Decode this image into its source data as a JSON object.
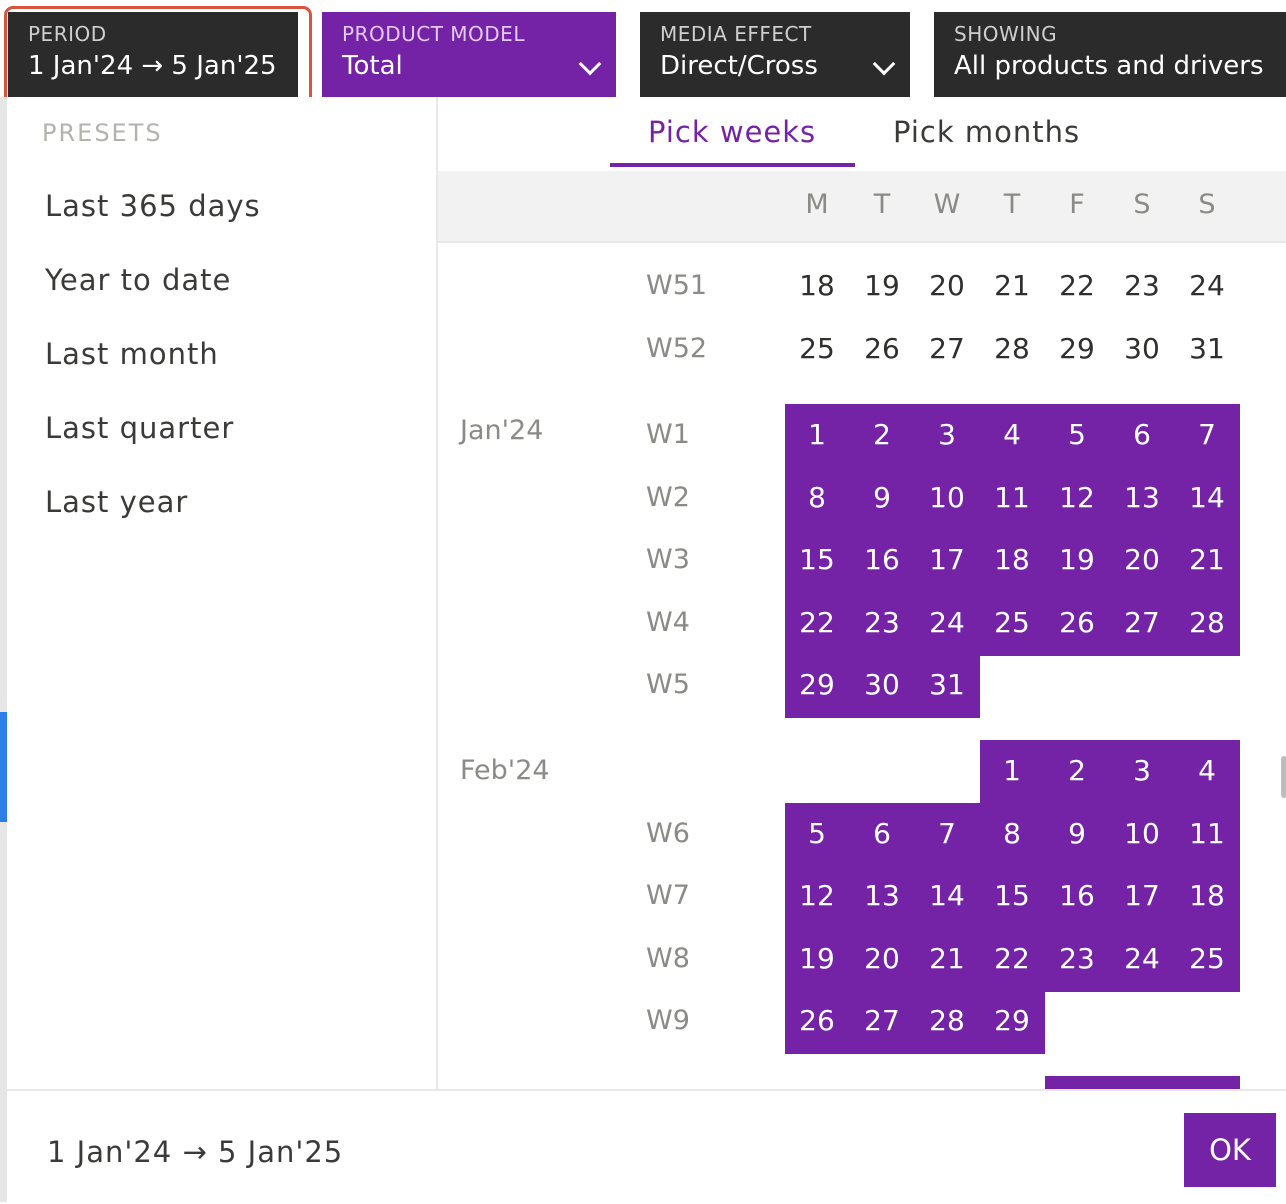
{
  "filters": {
    "period": {
      "label": "PERIOD",
      "value": "1 Jan'24 → 5 Jan'25"
    },
    "product_model": {
      "label": "PRODUCT MODEL",
      "value": "Total"
    },
    "media_effect": {
      "label": "MEDIA EFFECT",
      "value": "Direct/Cross"
    },
    "showing": {
      "label": "SHOWING",
      "value": "All products and drivers"
    }
  },
  "presets": {
    "title": "PRESETS",
    "items": [
      "Last 365 days",
      "Year to date",
      "Last month",
      "Last quarter",
      "Last year"
    ]
  },
  "tabs": {
    "weeks": "Pick weeks",
    "months": "Pick months",
    "active": "weeks"
  },
  "weekdays": [
    "M",
    "T",
    "W",
    "T",
    "F",
    "S",
    "S"
  ],
  "rows": [
    {
      "week": "W51",
      "month": "",
      "days": [
        "18",
        "19",
        "20",
        "21",
        "22",
        "23",
        "24"
      ],
      "selected": []
    },
    {
      "week": "W52",
      "month": "",
      "days": [
        "25",
        "26",
        "27",
        "28",
        "29",
        "30",
        "31"
      ],
      "selected": []
    },
    {
      "week": "W1",
      "month": "Jan'24",
      "days": [
        "1",
        "2",
        "3",
        "4",
        "5",
        "6",
        "7"
      ],
      "selected": [
        0,
        1,
        2,
        3,
        4,
        5,
        6
      ]
    },
    {
      "week": "W2",
      "month": "",
      "days": [
        "8",
        "9",
        "10",
        "11",
        "12",
        "13",
        "14"
      ],
      "selected": [
        0,
        1,
        2,
        3,
        4,
        5,
        6
      ]
    },
    {
      "week": "W3",
      "month": "",
      "days": [
        "15",
        "16",
        "17",
        "18",
        "19",
        "20",
        "21"
      ],
      "selected": [
        0,
        1,
        2,
        3,
        4,
        5,
        6
      ]
    },
    {
      "week": "W4",
      "month": "",
      "days": [
        "22",
        "23",
        "24",
        "25",
        "26",
        "27",
        "28"
      ],
      "selected": [
        0,
        1,
        2,
        3,
        4,
        5,
        6
      ]
    },
    {
      "week": "W5",
      "month": "",
      "days": [
        "29",
        "30",
        "31",
        "",
        "",
        "",
        ""
      ],
      "selected": [
        0,
        1,
        2
      ]
    },
    {
      "week": "",
      "month": "Feb'24",
      "days": [
        "",
        "",
        "",
        "1",
        "2",
        "3",
        "4"
      ],
      "selected": [
        3,
        4,
        5,
        6
      ]
    },
    {
      "week": "W6",
      "month": "",
      "days": [
        "5",
        "6",
        "7",
        "8",
        "9",
        "10",
        "11"
      ],
      "selected": [
        0,
        1,
        2,
        3,
        4,
        5,
        6
      ]
    },
    {
      "week": "W7",
      "month": "",
      "days": [
        "12",
        "13",
        "14",
        "15",
        "16",
        "17",
        "18"
      ],
      "selected": [
        0,
        1,
        2,
        3,
        4,
        5,
        6
      ]
    },
    {
      "week": "W8",
      "month": "",
      "days": [
        "19",
        "20",
        "21",
        "22",
        "23",
        "24",
        "25"
      ],
      "selected": [
        0,
        1,
        2,
        3,
        4,
        5,
        6
      ]
    },
    {
      "week": "W9",
      "month": "",
      "days": [
        "26",
        "27",
        "28",
        "29",
        "",
        "",
        ""
      ],
      "selected": [
        0,
        1,
        2,
        3
      ]
    },
    {
      "week": "",
      "month": "",
      "days": [
        "",
        "",
        "",
        "",
        "",
        "",
        ""
      ],
      "selected": [
        4,
        5,
        6
      ]
    }
  ],
  "footer": {
    "range": "1 Jan'24 → 5 Jan'25",
    "ok_label": "OK"
  },
  "colors": {
    "accent": "#7423a6",
    "filter_bg": "#2b2b2b",
    "highlight": "#d9533e"
  }
}
